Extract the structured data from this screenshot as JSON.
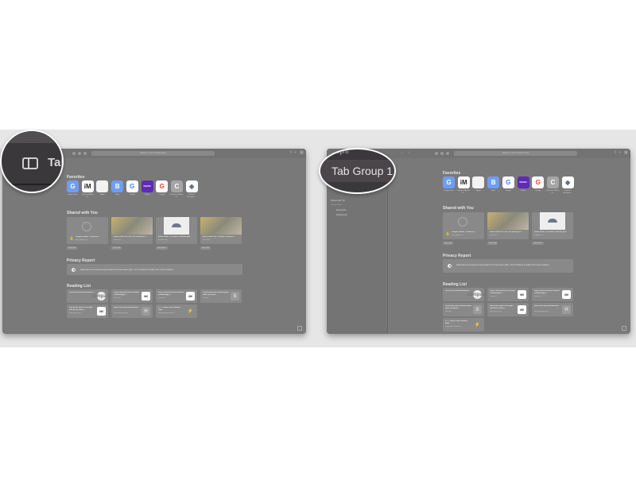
{
  "colors": {
    "window": "#7a797a",
    "band": "#e6e6e6",
    "magnifier": "#3b383b"
  },
  "left_magnifier": {
    "icon": "sidebar-toggle-icon",
    "text": "Tab"
  },
  "right_magnifier": {
    "header_text": "roups",
    "text": "Tab Group 1"
  },
  "toolbar": {
    "url_placeholder": "Search or enter website name"
  },
  "sidebar": {
    "section_label": "Collected Links",
    "items": [
      {
        "label": "Shared with You"
      },
      {
        "label": "Bookmarks"
      },
      {
        "label": "Reading List"
      }
    ]
  },
  "favorites": {
    "title": "Favorites",
    "items": [
      {
        "label": "Google Docs",
        "glyph": "G",
        "bg": "#6f9ef0",
        "fg": "#fff"
      },
      {
        "label": "Standard Article &...",
        "glyph": "iM",
        "bg": "#fff",
        "fg": "#222"
      },
      {
        "label": "Apple",
        "glyph": "",
        "bg": "#f2f2f2",
        "fg": "#555"
      },
      {
        "label": "Bing",
        "glyph": "B",
        "bg": "#6f9ef0",
        "fg": "#fff"
      },
      {
        "label": "Google",
        "glyph": "G",
        "bg": "#fff",
        "fg": "#4285f4"
      },
      {
        "label": "Yahoo",
        "glyph": "YAHOO!",
        "bg": "#5f2bb5",
        "fg": "#fff"
      },
      {
        "label": "Google",
        "glyph": "G",
        "bg": "#fff",
        "fg": "#ea4335"
      },
      {
        "label": "Chocolate Babka - S...",
        "glyph": "C",
        "bg": "#a5a5a5",
        "fg": "#fff"
      },
      {
        "label": "Natural Backgrou...",
        "glyph": "◆",
        "bg": "#fff",
        "fg": "#607080"
      }
    ]
  },
  "shared": {
    "title": "Shared with You",
    "items": [
      {
        "title": "Google Sheets - create an...",
        "site": "docs.google.com",
        "badge": "From Jake",
        "thumb": "compass"
      },
      {
        "title": "Weve Show 764: Are You Feeling St...",
        "site": "imore.com",
        "badge": "From Jake",
        "thumb": "photo"
      },
      {
        "title": "Weve show: 764 Karen Freeman pills",
        "site": "dropbox.com",
        "badge": "From Karen",
        "thumb": "dropbox"
      },
      {
        "title": "Weve Show 763: Privacy, Products,...",
        "site": "imore.com",
        "badge": "From Jake",
        "thumb": "photo"
      }
    ]
  },
  "privacy": {
    "title": "Privacy Report",
    "text": "Safari has not encountered any trackers in the last seven days. Your IP address is hidden from known trackers."
  },
  "reading_list": {
    "title": "Reading List",
    "items": [
      {
        "title": "file:///Users/lowe/Downloads...",
        "site": "",
        "icon": "compass"
      },
      {
        "title": "How to add and block contacts in WhatsApp f...",
        "site": "imore.com",
        "icon": "iM"
      },
      {
        "title": "How to add and block contacts in WhatsApp f...",
        "site": "imore.com",
        "icon": "iM"
      },
      {
        "title": "A morning robot calendar plays while my whole...",
        "site": "cnet.com",
        "icon": "S"
      },
      {
        "title": "Edit Article How to use apps with Siri on iPhon...",
        "site": "admin.imore.com",
        "icon": "iM"
      },
      {
        "title": "http:// ww1.parrsonsdandons...",
        "site": "parrsonsdandons.info",
        "icon": "H"
      },
      {
        "title": "# - 1 - Harry Potter Wizards Unite",
        "site": "harrypotterwizardsunite...",
        "icon": "⚡"
      }
    ]
  }
}
